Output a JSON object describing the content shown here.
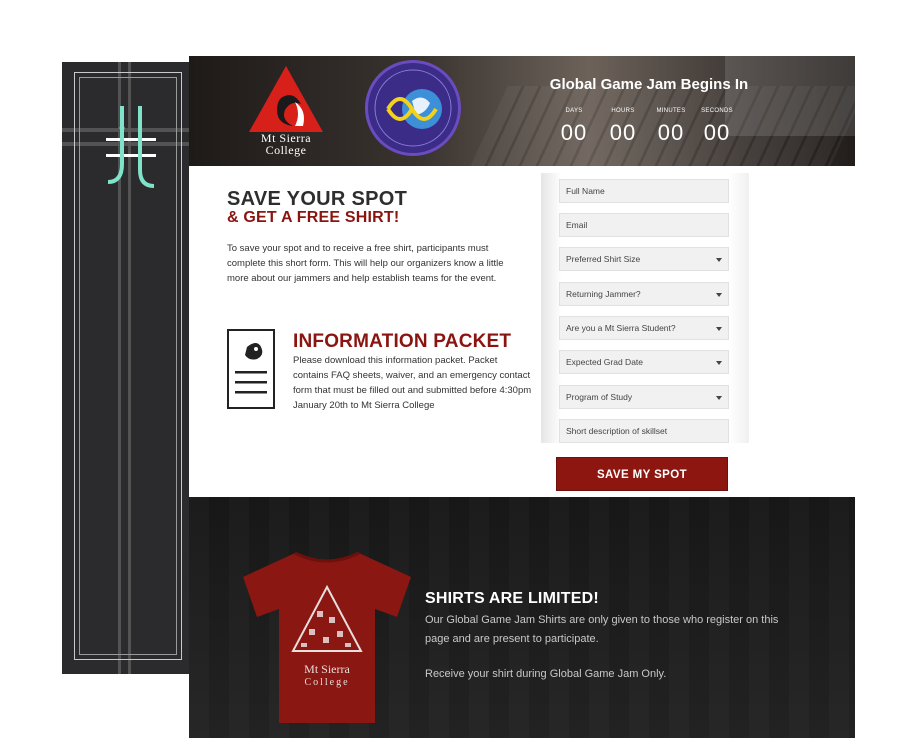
{
  "header": {
    "college_name_line1": "Mt Sierra",
    "college_name_line2": "College",
    "countdown_title": "Global Game Jam Begins In",
    "countdown": [
      {
        "label": "DAYS",
        "value": "00"
      },
      {
        "label": "HOURS",
        "value": "00"
      },
      {
        "label": "MINUTES",
        "value": "00"
      },
      {
        "label": "SECONDS",
        "value": "00"
      }
    ]
  },
  "intro": {
    "title": "SAVE YOUR SPOT",
    "subtitle": "& GET A FREE SHIRT!",
    "text": "To save your spot and to receive a free shirt, participants must complete this short form. This will help our organizers know a little more about our jammers and help establish teams for the event."
  },
  "info_packet": {
    "title": "INFORMATION PACKET",
    "text": "Please download this information packet. Packet contains FAQ sheets, waiver, and an emergency contact form that must be filled out and submitted before 4:30pm January 20th to Mt Sierra College"
  },
  "form": {
    "fields": [
      {
        "placeholder": "Full Name",
        "type": "text"
      },
      {
        "placeholder": "Email",
        "type": "text"
      },
      {
        "placeholder": "Preferred Shirt Size",
        "type": "select"
      },
      {
        "placeholder": "Returning Jammer?",
        "type": "select"
      },
      {
        "placeholder": "Are you a Mt Sierra Student?",
        "type": "select"
      },
      {
        "placeholder": "Expected Grad Date",
        "type": "select"
      },
      {
        "placeholder": "Program of Study",
        "type": "select"
      },
      {
        "placeholder": "Short description of skillset",
        "type": "text"
      }
    ],
    "submit_label": "SAVE MY SPOT"
  },
  "shirts": {
    "title": "SHIRTS ARE LIMITED!",
    "text": "Our Global Game Jam Shirts are only given to those who register on this page and are present to participate.",
    "text2": "Receive your shirt during Global Game Jam Only.",
    "shirt_line1": "Mt Sierra",
    "shirt_line2": "College"
  },
  "colors": {
    "accent": "#8d1710",
    "dark_bg": "#1c1c1c",
    "back_card": "#2b2b2d",
    "logo_teal": "#7fe3c9"
  }
}
